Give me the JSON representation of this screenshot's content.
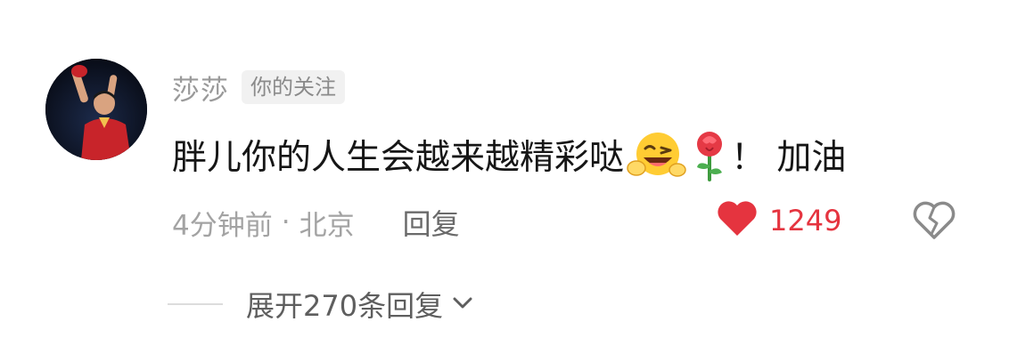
{
  "comment": {
    "username": "莎莎",
    "follow_badge": "你的关注",
    "text_main": "胖儿你的人生会越来越精彩哒",
    "text_tail": "！ 加油",
    "emojis": [
      "grinning-wink-emoji",
      "rose-emoji"
    ],
    "time": "4分钟前",
    "separator": "·",
    "location": "北京",
    "reply_label": "回复",
    "like_count": "1249",
    "expand_replies_label": "展开270条回复"
  },
  "colors": {
    "like": "#e5343f",
    "username": "#9a9a9a",
    "text": "#161616"
  }
}
